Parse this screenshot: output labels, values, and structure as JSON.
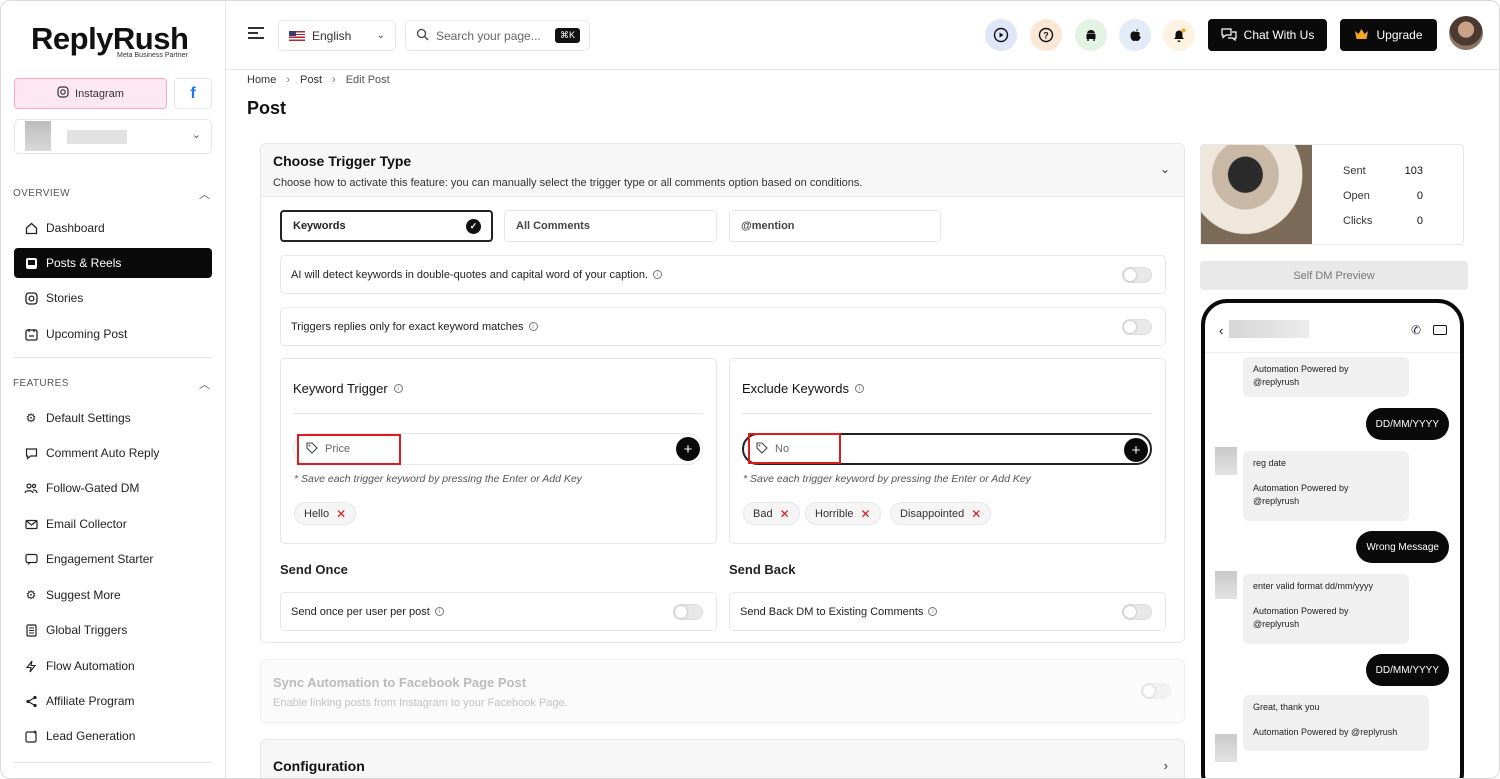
{
  "brand": {
    "name": "ReplyRush",
    "badge": "Meta Business Partner"
  },
  "channels": {
    "instagram": "Instagram",
    "facebook": "f"
  },
  "sidebar": {
    "overview_label": "OVERVIEW",
    "features_label": "FEATURES",
    "overview_items": [
      {
        "label": "Dashboard",
        "icon": "home-icon"
      },
      {
        "label": "Posts & Reels",
        "icon": "image-icon"
      },
      {
        "label": "Stories",
        "icon": "instagram-icon"
      },
      {
        "label": "Upcoming Post",
        "icon": "calendar-icon"
      }
    ],
    "feature_items": [
      {
        "label": "Default Settings",
        "icon": "gear-icon"
      },
      {
        "label": "Comment Auto Reply",
        "icon": "comment-icon"
      },
      {
        "label": "Follow-Gated DM",
        "icon": "users-icon"
      },
      {
        "label": "Email Collector",
        "icon": "mail-icon"
      },
      {
        "label": "Engagement Starter",
        "icon": "chat-icon"
      },
      {
        "label": "Suggest More",
        "icon": "sparkle-gear-icon"
      },
      {
        "label": "Global Triggers",
        "icon": "list-icon"
      },
      {
        "label": "Flow Automation",
        "icon": "bolt-icon"
      },
      {
        "label": "Affiliate Program",
        "icon": "share-icon"
      },
      {
        "label": "Lead Generation",
        "icon": "lead-icon"
      }
    ]
  },
  "topbar": {
    "language": "English",
    "search_placeholder": "Search your page...",
    "shortcut": "⌘K",
    "chat_label": "Chat With Us",
    "upgrade_label": "Upgrade"
  },
  "breadcrumb": [
    "Home",
    "Post",
    "Edit Post"
  ],
  "page_title": "Post",
  "trigger": {
    "title": "Choose Trigger Type",
    "subtitle": "Choose how to activate this feature: you can manually select the trigger type or all comments option based on conditions.",
    "options": [
      "Keywords",
      "All Comments",
      "@mention"
    ],
    "ai_detect": "AI will detect keywords in double-quotes and capital word of your caption.",
    "exact_match": "Triggers replies only for exact keyword matches",
    "keyword_trigger": {
      "title": "Keyword Trigger",
      "input_value": "Price",
      "hint": "* Save each trigger keyword by pressing the Enter or Add Key",
      "chips": [
        "Hello"
      ]
    },
    "exclude": {
      "title": "Exclude Keywords",
      "input_value": "No",
      "hint": "* Save each trigger keyword by pressing the Enter or Add Key",
      "chips": [
        "Bad",
        "Horrible",
        "Disappointed"
      ]
    },
    "send_once": {
      "heading": "Send Once",
      "label": "Send once per user per post"
    },
    "send_back": {
      "heading": "Send Back",
      "label": "Send Back DM to Existing Comments"
    }
  },
  "sync": {
    "title": "Sync Automation to Facebook Page Post",
    "subtitle": "Enable linking posts from Instagram to your Facebook Page."
  },
  "configuration": {
    "title": "Configuration"
  },
  "stats": {
    "sent_label": "Sent",
    "sent": "103",
    "open_label": "Open",
    "open": "0",
    "clicks_label": "Clicks",
    "clicks": "0"
  },
  "preview": {
    "button": "Self DM Preview",
    "messages": {
      "m1_l2": "Automation Powered by",
      "m1_l3": "@replyrush",
      "out1": "DD/MM/YYYY",
      "m2_l1": "reg date",
      "m2_l2": "Automation Powered by",
      "m2_l3": "@replyrush",
      "out2": "Wrong Message",
      "m3_l1": "enter valid format dd/mm/yyyy",
      "m3_l2": "Automation Powered by",
      "m3_l3": "@replyrush",
      "out3": "DD/MM/YYYY",
      "m4_l1": "Great, thank you",
      "m4_l2": "Automation Powered by @replyrush"
    }
  }
}
